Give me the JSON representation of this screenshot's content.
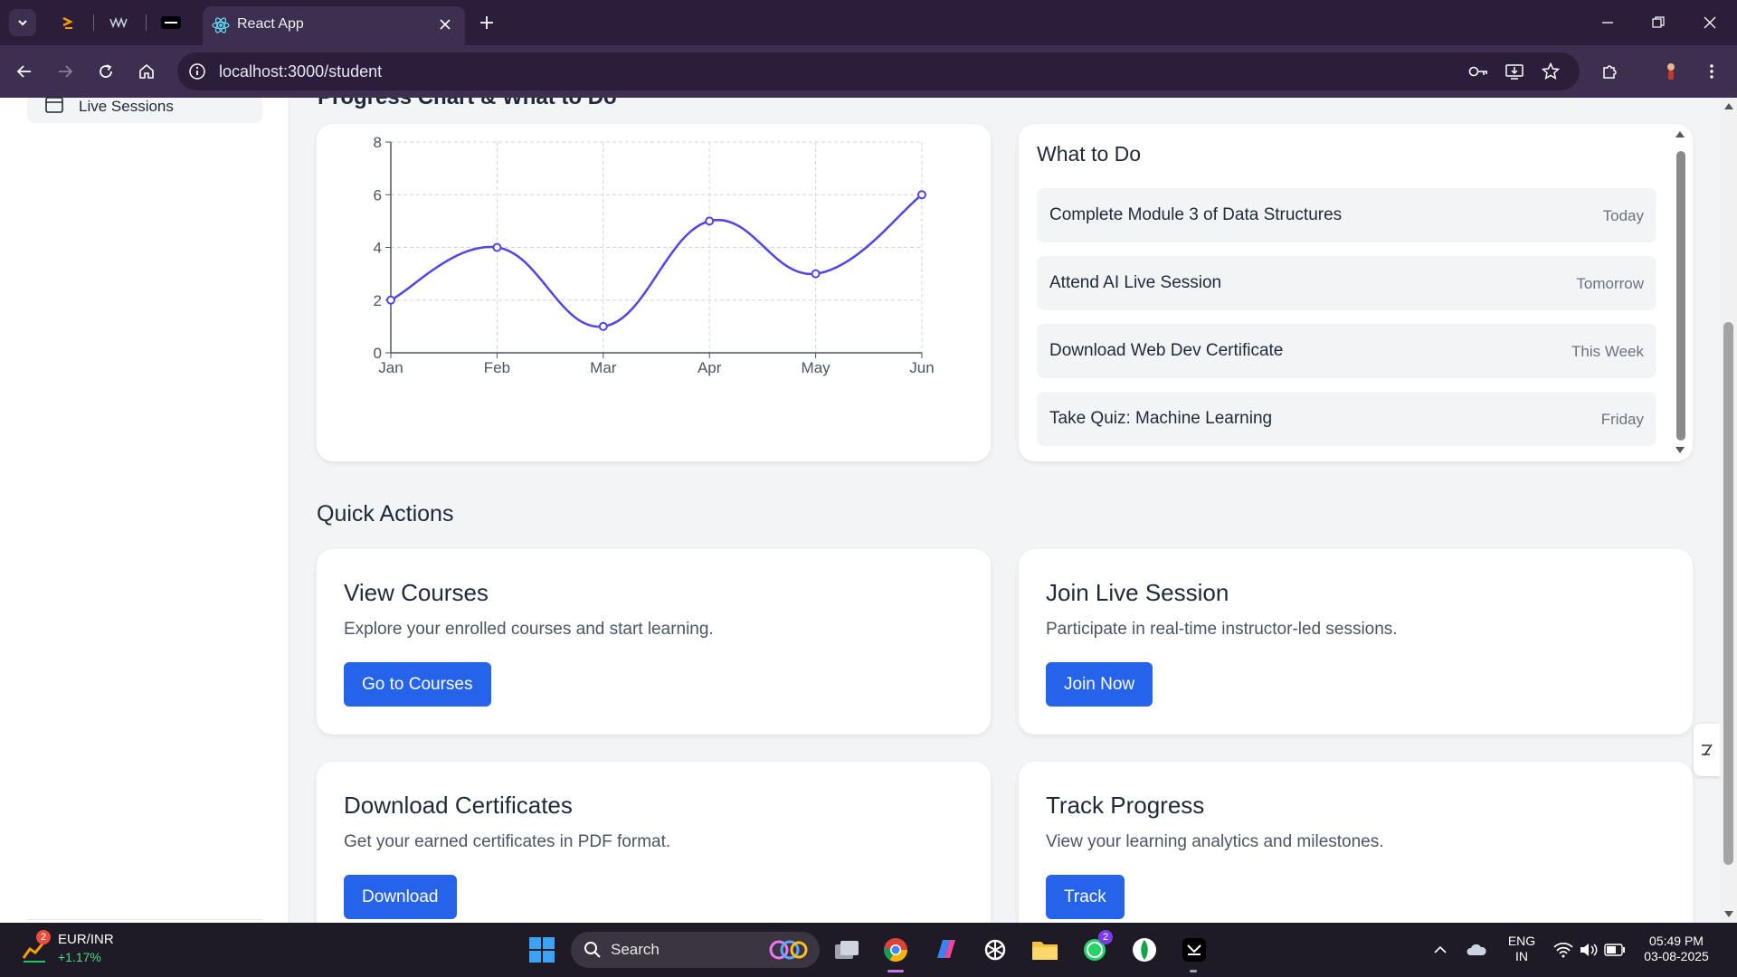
{
  "browser": {
    "active_tab_title": "React App",
    "url": "localhost:3000/student"
  },
  "sidebar": {
    "items": [
      {
        "label": "Live Sessions"
      }
    ]
  },
  "main": {
    "partial_heading": "Progress Chart & What to Do",
    "todo": {
      "title": "What to Do",
      "items": [
        {
          "task": "Complete Module 3 of Data Structures",
          "when": "Today"
        },
        {
          "task": "Attend AI Live Session",
          "when": "Tomorrow"
        },
        {
          "task": "Download Web Dev Certificate",
          "when": "This Week"
        },
        {
          "task": "Take Quiz: Machine Learning",
          "when": "Friday"
        }
      ]
    },
    "quick_actions": {
      "heading": "Quick Actions",
      "cards": [
        {
          "title": "View Courses",
          "description": "Explore your enrolled courses and start learning.",
          "button": "Go to Courses"
        },
        {
          "title": "Join Live Session",
          "description": "Participate in real-time instructor-led sessions.",
          "button": "Join Now"
        },
        {
          "title": "Download Certificates",
          "description": "Get your earned certificates in PDF format.",
          "button": "Download"
        },
        {
          "title": "Track Progress",
          "description": "View your learning analytics and milestones.",
          "button": "Track"
        }
      ]
    }
  },
  "chart_data": {
    "type": "line",
    "categories": [
      "Jan",
      "Feb",
      "Mar",
      "Apr",
      "May",
      "Jun"
    ],
    "values": [
      2,
      4,
      1,
      5,
      3,
      6
    ],
    "ylim": [
      0,
      8
    ],
    "yticks": [
      "0",
      "2",
      "4",
      "6",
      "8"
    ],
    "grid": true,
    "line_color": "#4f46e5",
    "smooth": true
  },
  "taskbar": {
    "widget_name": "EUR/INR",
    "widget_value": "+1.17%",
    "widget_badge": "2",
    "search_label": "Search",
    "whatsapp_badge": "2",
    "lang_line1": "ENG",
    "lang_line2": "IN",
    "time": "05:49 PM",
    "date": "03-08-2025"
  },
  "colors": {
    "accent": "#2563eb",
    "tab_bg": "#2b1e3b",
    "toolbar_bg": "#3d2f4f"
  }
}
